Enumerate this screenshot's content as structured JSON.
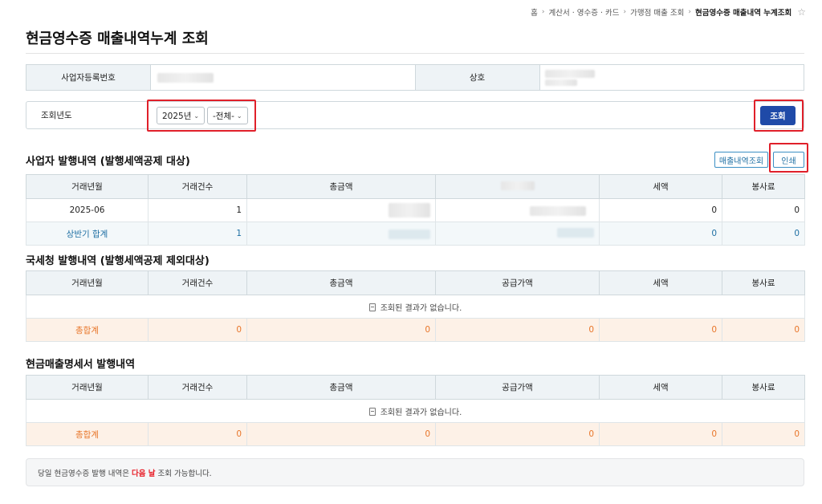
{
  "breadcrumb": {
    "items": [
      "홈",
      "계산서 · 영수증 · 카드",
      "가맹점 매출 조회"
    ],
    "current": "현금영수증 매출내역 누계조회"
  },
  "page_title": "현금영수증 매출내역누계 조회",
  "info": {
    "reg_no_label": "사업자등록번호",
    "name_label": "상호"
  },
  "search": {
    "year_label": "조회년도",
    "year_value": "2025년",
    "period_value": "-전체-",
    "submit_label": "조회"
  },
  "business_section": {
    "title": "사업자 발행내역 (발행세액공제 대상)",
    "sales_inquiry_label": "매출내역조회",
    "print_label": "인쇄",
    "headers": [
      "거래년월",
      "거래건수",
      "총금액",
      "",
      "세액",
      "봉사료"
    ],
    "rows": [
      {
        "month": "2025-06",
        "count": "1",
        "tax": "0",
        "service": "0"
      }
    ],
    "subtotal": {
      "month": "상반기 합계",
      "count": "1",
      "tax": "0",
      "service": "0"
    }
  },
  "nts_section": {
    "title": "국세청 발행내역 (발행세액공제 제외대상)",
    "headers": [
      "거래년월",
      "거래건수",
      "총금액",
      "공급가액",
      "세액",
      "봉사료"
    ],
    "empty_text": "조회된 결과가 없습니다.",
    "total": {
      "label": "총합계",
      "count": "0",
      "amount": "0",
      "supply": "0",
      "tax": "0",
      "service": "0"
    }
  },
  "statement_section": {
    "title": "현금매출명세서 발행내역",
    "headers": [
      "거래년월",
      "거래건수",
      "총금액",
      "공급가액",
      "세액",
      "봉사료"
    ],
    "empty_text": "조회된 결과가 없습니다.",
    "total": {
      "label": "총합계",
      "count": "0",
      "amount": "0",
      "supply": "0",
      "tax": "0",
      "service": "0"
    }
  },
  "notice": {
    "prefix": "당일 현금영수증 발행 내역은",
    "highlight": "다음 날",
    "suffix": "조회 가능합니다."
  },
  "colors": {
    "primary": "#1f4aa8",
    "highlight_frame": "#e0202a",
    "subtotal_text": "#1e6fa3",
    "total_text": "#e8762a",
    "total_bg": "#fdf1e7",
    "header_bg": "#eef3f6"
  }
}
